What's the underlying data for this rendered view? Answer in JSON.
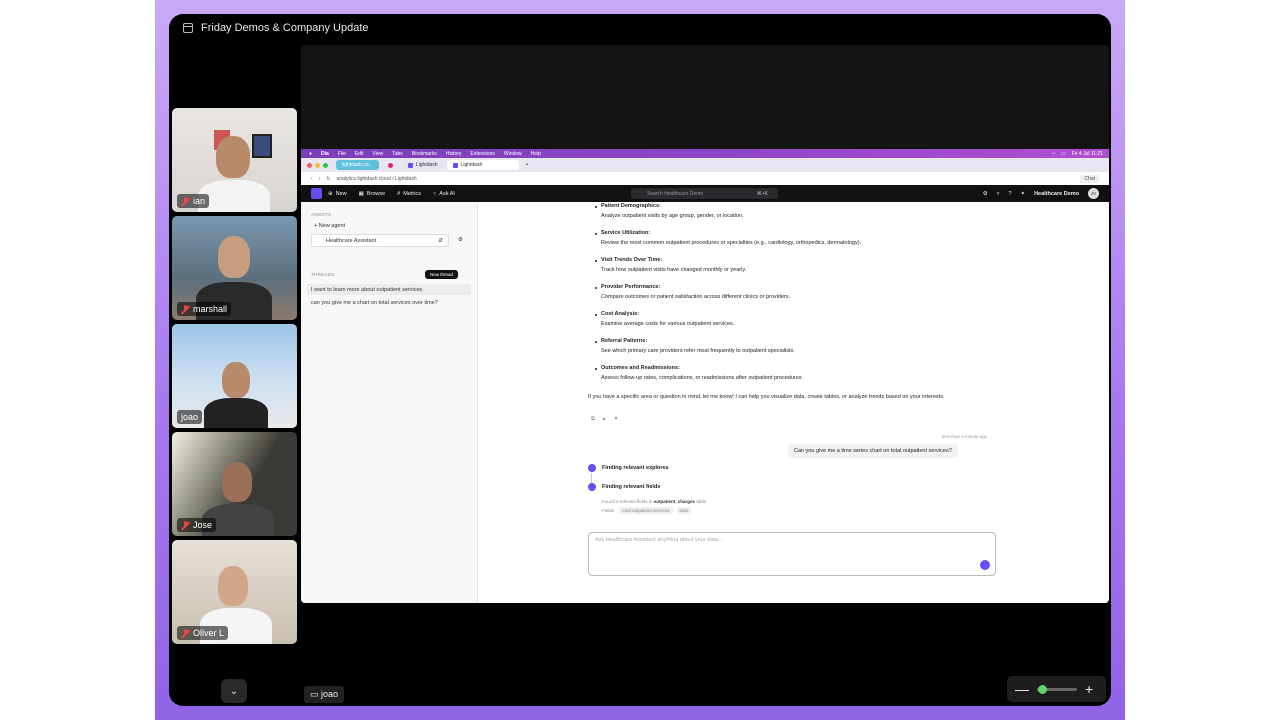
{
  "window": {
    "title": "Friday Demos & Company Update",
    "presenter_label": "joao",
    "zoom_fraction": 0.02
  },
  "participants": [
    {
      "name": "ian",
      "muted": true,
      "active": false
    },
    {
      "name": "marshall",
      "muted": true,
      "active": false
    },
    {
      "name": "joao",
      "muted": false,
      "active": true
    },
    {
      "name": "Jose",
      "muted": true,
      "active": false
    },
    {
      "name": "Oliver L",
      "muted": true,
      "active": false
    }
  ],
  "mac": {
    "menu": [
      "Dia",
      "File",
      "Edit",
      "View",
      "Tabs",
      "Bookmarks",
      "History",
      "Extensions",
      "Window",
      "Help"
    ],
    "clock": "Fri 4 Jul 11:21"
  },
  "browser": {
    "tabs": [
      "lightdash.co...",
      "Lightdash",
      "Lightdash"
    ],
    "url": "analytics.lightdash.cloud / Lightdash",
    "chat_label": "Chat"
  },
  "lightdash": {
    "nav": [
      "New",
      "Browse",
      "Metrics",
      "Ask AI"
    ],
    "search_placeholder": "Search Healthcare Demo",
    "search_shortcut": "⌘+K",
    "project": "Healthcare Demo",
    "avatar": "JV",
    "sidebar": {
      "agents_header": "AGENTS",
      "new_agent": "New agent",
      "agent_name": "Healthcare Assistant",
      "threads_header": "THREADS",
      "new_thread": "New thread",
      "threads": [
        "I want to learn more about outpatient services",
        "can you give me a chart on total services over time?"
      ]
    },
    "chat": {
      "items": [
        {
          "title": "Patient Demographics:",
          "desc": "Analyze outpatient visits by age group, gender, or location."
        },
        {
          "title": "Service Utilization:",
          "desc": "Review the most common outpatient procedures or specialties (e.g., cardiology, orthopedics, dermatology)."
        },
        {
          "title": "Visit Trends Over Time:",
          "desc": "Track how outpatient visits have changed monthly or yearly."
        },
        {
          "title": "Provider Performance:",
          "desc": "Compare outcomes or patient satisfaction across different clinics or providers."
        },
        {
          "title": "Cost Analysis:",
          "desc": "Examine average costs for various outpatient services."
        },
        {
          "title": "Referral Patterns:",
          "desc": "See which primary care providers refer most frequently to outpatient specialists."
        },
        {
          "title": "Outcomes and Readmissions:",
          "desc": "Assess follow-up rates, complications, or readmissions after outpatient procedures."
        }
      ],
      "closing": "If you have a specific area or question in mind, let me know! I can help you visualize data, create tables, or analyze trends based on your interests.",
      "timestamp": "less than a minute ago",
      "user_msg": "Can you give me a time series chart on total outpatient services?",
      "step1": "Finding relevant explores",
      "step2": "Finding relevant fields",
      "found_prefix": "Found 2 relevant fields in",
      "found_table": "outpatient_charges",
      "found_suffix": "table",
      "fields_label": "Fields:",
      "fields": [
        "total outpatient services",
        "date"
      ],
      "input_placeholder": "Ask Healthcare Assistant anything about your data..."
    }
  }
}
